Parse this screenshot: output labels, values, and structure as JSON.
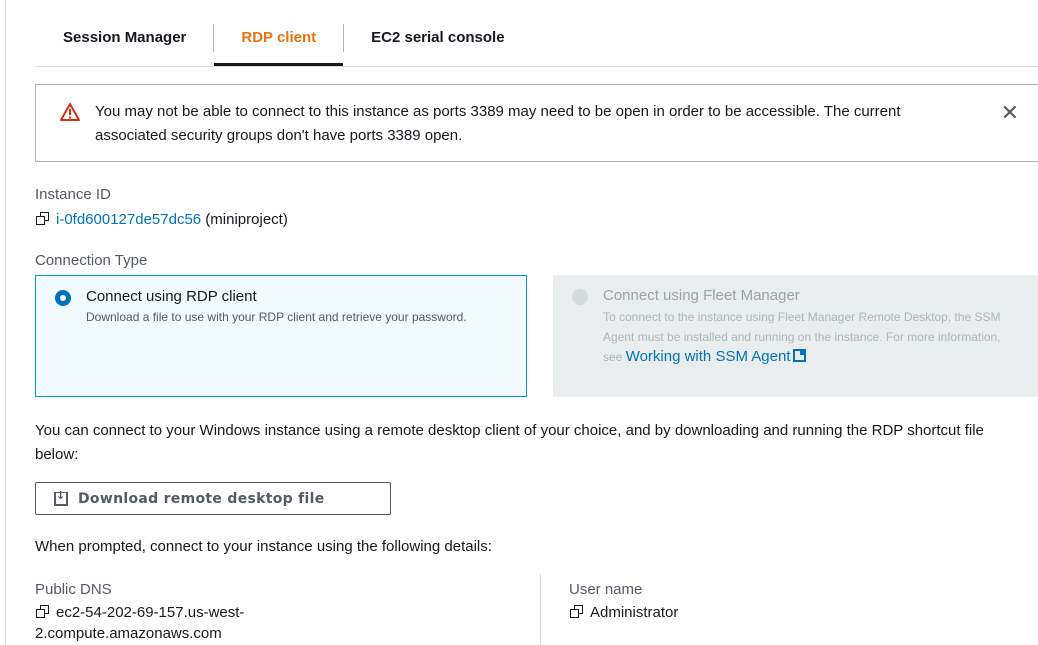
{
  "tabs": [
    {
      "label": "Session Manager",
      "active": false
    },
    {
      "label": "RDP client",
      "active": true
    },
    {
      "label": "EC2 serial console",
      "active": false
    }
  ],
  "alert": {
    "icon": "warning-triangle-icon",
    "text": "You may not be able to connect to this instance as ports 3389 may need to be open in order to be accessible. The current associated security groups don't have ports 3389 open.",
    "close_icon": "close-icon"
  },
  "instance": {
    "label": "Instance ID",
    "id": "i-0fd600127de57dc56",
    "name": " (miniproject)"
  },
  "connection_type": {
    "label": "Connection Type",
    "options": [
      {
        "title": "Connect using RDP client",
        "description": "Download a file to use with your RDP client and retrieve your password.",
        "selected": true
      },
      {
        "title": "Connect using Fleet Manager",
        "description": "To connect to the instance using Fleet Manager Remote Desktop, the SSM Agent must be installed and running on the instance. For more information, see ",
        "link_text": "Working with SSM Agent",
        "selected": false,
        "disabled": true
      }
    ]
  },
  "info_paragraph": "You can connect to your Windows instance using a remote desktop client of your choice, and by downloading and running the RDP shortcut file below:",
  "download_button": {
    "label": "Download remote desktop file",
    "icon": "download-icon"
  },
  "prompt_text": "When prompted, connect to your instance using the following details:",
  "details": {
    "public_dns_label": "Public DNS",
    "public_dns_line1": "ec2-54-202-69-157.us-west-",
    "public_dns_line2": "2.compute.amazonaws.com",
    "username_label": "User name",
    "username": "Administrator"
  },
  "colors": {
    "accent": "#ec7211",
    "link": "#0073bb",
    "selected_border": "#00a1c9",
    "warning": "#d13212"
  }
}
